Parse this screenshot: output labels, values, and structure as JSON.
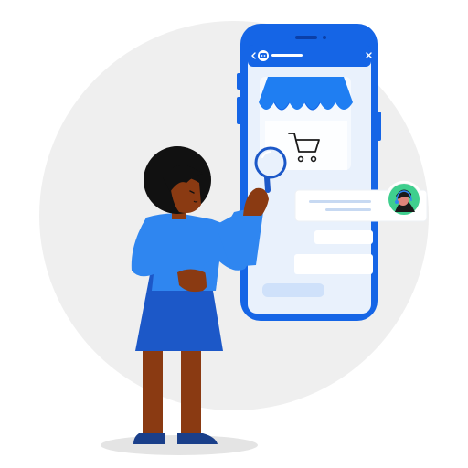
{
  "illustration": {
    "subject": "woman-with-magnifier-viewing-phone-store",
    "colors": {
      "background_circle": "#efefef",
      "phone_frame": "#1565e6",
      "phone_screen": "#e9f1fc",
      "awning": "#1f7ef2",
      "shirt": "#2f86f0",
      "skirt": "#1c58c8",
      "skin": "#8a3a12",
      "hair": "#111111",
      "shoes": "#1a3f8a",
      "agent_badge_bg": "#3fcf8e",
      "bubble_bg": "#ffffff",
      "bubble_line": "#c7d9f2"
    }
  },
  "phone": {
    "header_icon": "bot-icon",
    "close_icon": "close-icon",
    "back_icon": "chevron-left-icon",
    "store_icon": "storefront-awning-icon",
    "cart_icon": "shopping-cart-icon"
  },
  "chat": {
    "agent_icon": "agent-avatar-icon"
  }
}
